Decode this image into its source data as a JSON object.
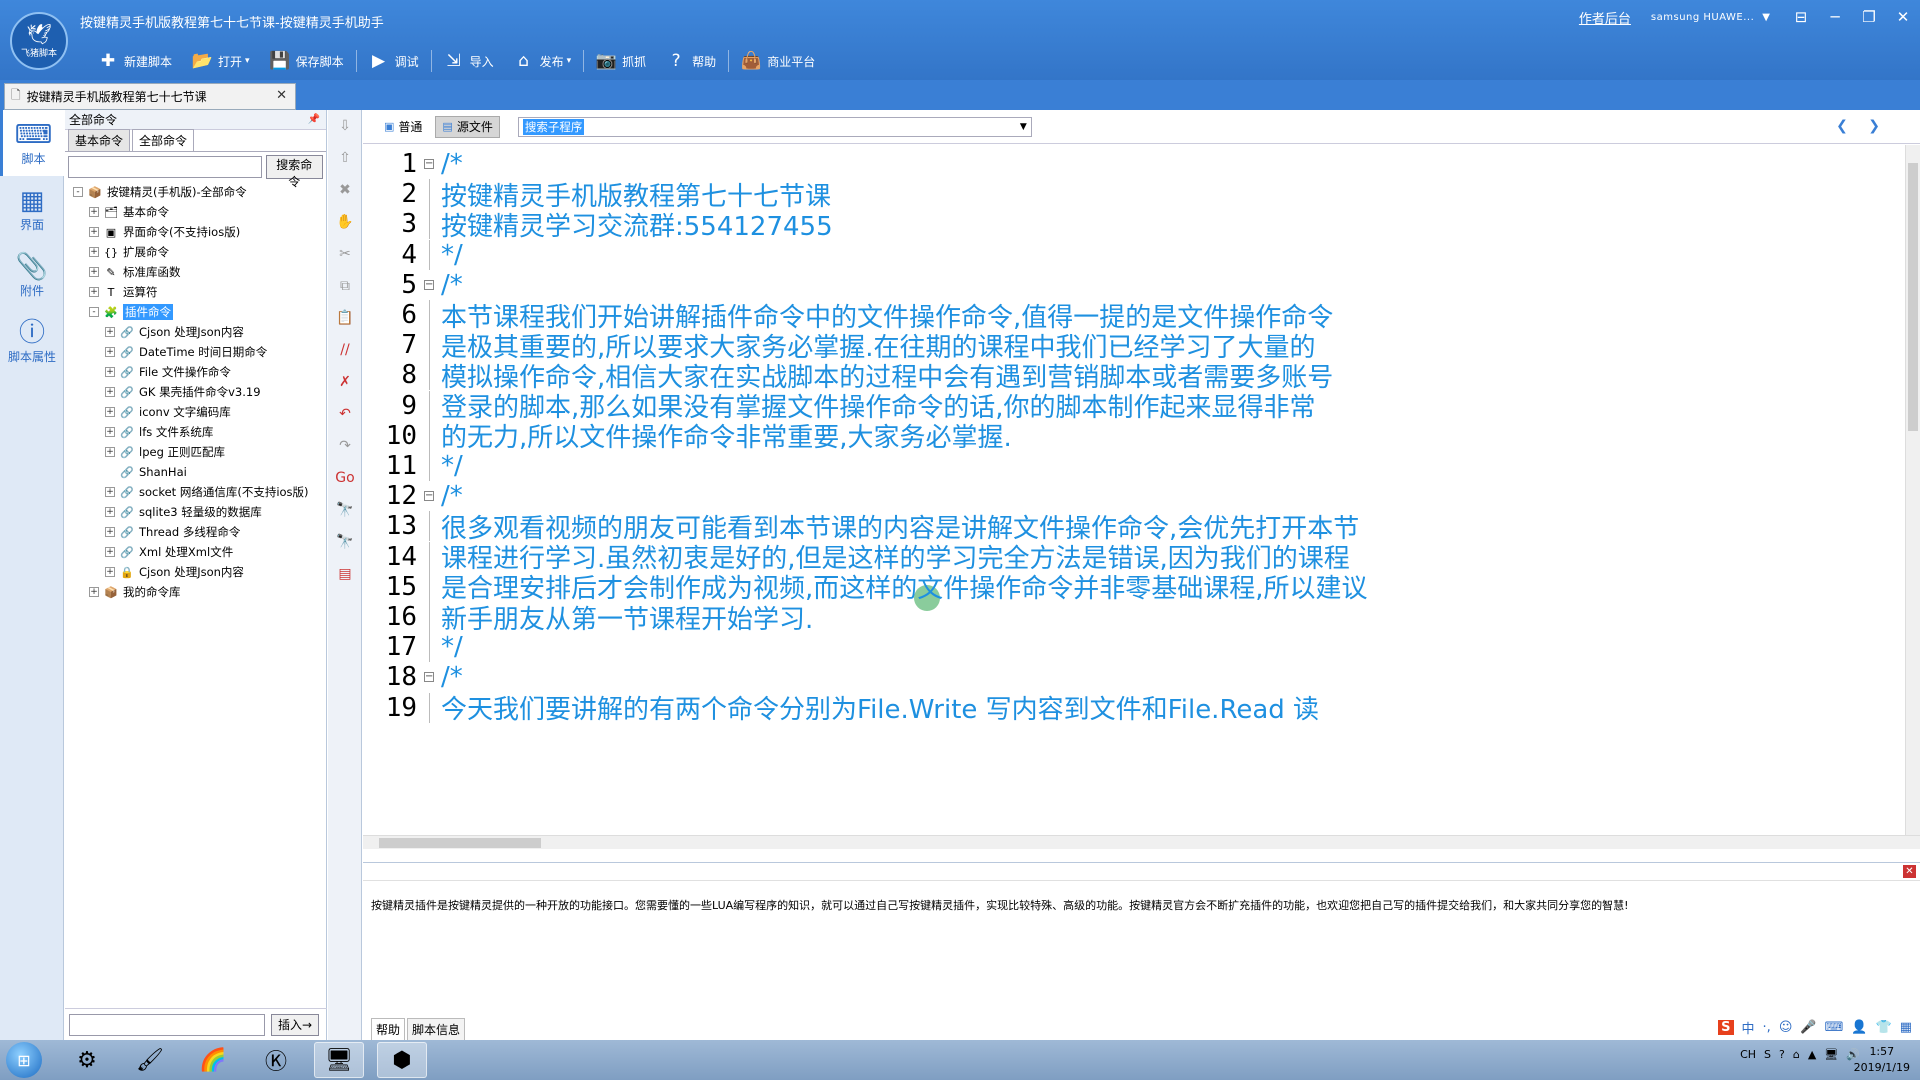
{
  "app": {
    "logo_text": "飞猪脚本",
    "window_title": "按键精灵手机版教程第七十七节课-按键精灵手机助手",
    "admin_link": "作者后台",
    "device": "samsung HUAWE...",
    "toolbar": [
      {
        "label": "新建脚本",
        "icon": "plus-icon",
        "glyph": "✚"
      },
      {
        "label": "打开",
        "icon": "folder-icon",
        "glyph": "📂",
        "dropdown": true
      },
      {
        "label": "保存脚本",
        "icon": "save-icon",
        "glyph": "💾"
      },
      {
        "label": "调试",
        "icon": "play-icon",
        "glyph": "▶"
      },
      {
        "label": "导入",
        "icon": "import-icon",
        "glyph": "⇲"
      },
      {
        "label": "发布",
        "icon": "publish-icon",
        "glyph": "⌂",
        "dropdown": true
      },
      {
        "label": "抓抓",
        "icon": "camera-icon",
        "glyph": "📷"
      },
      {
        "label": "帮助",
        "icon": "help-icon",
        "glyph": "?"
      },
      {
        "label": "商业平台",
        "icon": "shop-icon",
        "glyph": "👜"
      }
    ]
  },
  "doc_tab": {
    "label": "按键精灵手机版教程第七十七节课"
  },
  "left_nav": [
    {
      "label": "脚本",
      "icon": "script-icon",
      "glyph": "⌨"
    },
    {
      "label": "界面",
      "icon": "grid-icon",
      "glyph": "▦"
    },
    {
      "label": "附件",
      "icon": "attachment-icon",
      "glyph": "📎"
    },
    {
      "label": "脚本属性",
      "icon": "info-icon",
      "glyph": "ⓘ"
    }
  ],
  "command_panel": {
    "header": "全部命令",
    "pin": "📌",
    "tabs": [
      "基本命令",
      "全部命令"
    ],
    "search_button": "搜索命令",
    "insert_button": "插入→",
    "tree": [
      {
        "label": "按键精灵(手机版)-全部命令",
        "level": 0,
        "exp": "-",
        "icon": "📦"
      },
      {
        "label": "基本命令",
        "level": 1,
        "exp": "+",
        "icon": "🗂"
      },
      {
        "label": "界面命令(不支持ios版)",
        "level": 1,
        "exp": "+",
        "icon": "▣"
      },
      {
        "label": "扩展命令",
        "level": 1,
        "exp": "+",
        "icon": "{}"
      },
      {
        "label": "标准库函数",
        "level": 1,
        "exp": "+",
        "icon": "✎"
      },
      {
        "label": "运算符",
        "level": 1,
        "exp": "+",
        "icon": "T"
      },
      {
        "label": "插件命令",
        "level": 1,
        "exp": "-",
        "icon": "🧩",
        "selected": true
      },
      {
        "label": "Cjson 处理Json内容",
        "level": 2,
        "exp": "+",
        "icon": "🔗"
      },
      {
        "label": "DateTime 时间日期命令",
        "level": 2,
        "exp": "+",
        "icon": "🔗"
      },
      {
        "label": "File 文件操作命令",
        "level": 2,
        "exp": "+",
        "icon": "🔗"
      },
      {
        "label": "GK 果壳插件命令v3.19",
        "level": 2,
        "exp": "+",
        "icon": "🔗"
      },
      {
        "label": "iconv 文字编码库",
        "level": 2,
        "exp": "+",
        "icon": "🔗"
      },
      {
        "label": "lfs 文件系统库",
        "level": 2,
        "exp": "+",
        "icon": "🔗"
      },
      {
        "label": "lpeg 正则匹配库",
        "level": 2,
        "exp": "+",
        "icon": "🔗"
      },
      {
        "label": "ShanHai",
        "level": 2,
        "exp": "",
        "icon": "🔗"
      },
      {
        "label": "socket 网络通信库(不支持ios版)",
        "level": 2,
        "exp": "+",
        "icon": "🔗"
      },
      {
        "label": "sqlite3 轻量级的数据库",
        "level": 2,
        "exp": "+",
        "icon": "🔗"
      },
      {
        "label": "Thread 多线程命令",
        "level": 2,
        "exp": "+",
        "icon": "🔗"
      },
      {
        "label": "Xml 处理Xml文件",
        "level": 2,
        "exp": "+",
        "icon": "🔗"
      },
      {
        "label": "Cjson 处理Json内容",
        "level": 2,
        "exp": "+",
        "icon": "🔒"
      },
      {
        "label": "我的命令库",
        "level": 1,
        "exp": "+",
        "icon": "📦"
      }
    ]
  },
  "vtools": [
    {
      "icon": "arrow-down-icon",
      "glyph": "⇩",
      "on": false
    },
    {
      "icon": "arrow-up-icon",
      "glyph": "⇧",
      "on": false
    },
    {
      "icon": "delete-icon",
      "glyph": "✖",
      "on": false
    },
    {
      "icon": "hand-icon",
      "glyph": "✋",
      "on": true
    },
    {
      "icon": "cut-icon",
      "glyph": "✂",
      "on": false
    },
    {
      "icon": "copy-icon",
      "glyph": "⧉",
      "on": false
    },
    {
      "icon": "paste-icon",
      "glyph": "📋",
      "on": false
    },
    {
      "icon": "comment-icon",
      "glyph": "//",
      "on": true
    },
    {
      "icon": "uncomment-icon",
      "glyph": "✗",
      "on": true
    },
    {
      "icon": "undo-icon",
      "glyph": "↶",
      "on": true
    },
    {
      "icon": "redo-icon",
      "glyph": "↷",
      "on": false
    },
    {
      "icon": "goto-icon",
      "glyph": "Go",
      "on": true
    },
    {
      "icon": "find-icon",
      "glyph": "🔭",
      "on": true
    },
    {
      "icon": "replace-icon",
      "glyph": "🔭",
      "on": true
    },
    {
      "icon": "format-icon",
      "glyph": "▤",
      "on": true
    }
  ],
  "editor": {
    "modes": [
      {
        "label": "普通",
        "icon": "normal-view-icon",
        "glyph": "▣"
      },
      {
        "label": "源文件",
        "icon": "source-view-icon",
        "glyph": "▤",
        "active": true
      }
    ],
    "subroutine_select": "搜索子程序",
    "prev": "❮",
    "next": "❯",
    "lines": [
      {
        "n": "1",
        "text": "/*",
        "fold": "start"
      },
      {
        "n": "2",
        "text": "按键精灵手机版教程第七十七节课",
        "fold": "mid"
      },
      {
        "n": "3",
        "text": "按键精灵学习交流群:554127455",
        "fold": "mid"
      },
      {
        "n": "4",
        "text": "*/",
        "fold": "end"
      },
      {
        "n": "5",
        "text": "/*",
        "fold": "start"
      },
      {
        "n": "6",
        "text": "本节课程我们开始讲解插件命令中的文件操作命令,值得一提的是文件操作命令",
        "fold": "mid"
      },
      {
        "n": "7",
        "text": "是极其重要的,所以要求大家务必掌握.在往期的课程中我们已经学习了大量的",
        "fold": "mid"
      },
      {
        "n": "8",
        "text": "模拟操作命令,相信大家在实战脚本的过程中会有遇到营销脚本或者需要多账号",
        "fold": "mid"
      },
      {
        "n": "9",
        "text": "登录的脚本,那么如果没有掌握文件操作命令的话,你的脚本制作起来显得非常",
        "fold": "mid"
      },
      {
        "n": "10",
        "text": "的无力,所以文件操作命令非常重要,大家务必掌握.",
        "fold": "mid"
      },
      {
        "n": "11",
        "text": "*/",
        "fold": "end"
      },
      {
        "n": "12",
        "text": "/*",
        "fold": "start"
      },
      {
        "n": "13",
        "text": "很多观看视频的朋友可能看到本节课的内容是讲解文件操作命令,会优先打开本节",
        "fold": "mid"
      },
      {
        "n": "14",
        "text": "课程进行学习.虽然初衷是好的,但是这样的学习完全方法是错误,因为我们的课程",
        "fold": "mid"
      },
      {
        "n": "15",
        "text": "是合理安排后才会制作成为视频,而这样的文件操作命令并非零基础课程,所以建议",
        "fold": "mid"
      },
      {
        "n": "16",
        "text": "新手朋友从第一节课程开始学习.",
        "fold": "mid"
      },
      {
        "n": "17",
        "text": "*/",
        "fold": "end"
      },
      {
        "n": "18",
        "text": "/*",
        "fold": "start"
      },
      {
        "n": "19",
        "text": "今天我们要讲解的有两个命令分别为File.Write 写内容到文件和File.Read 读",
        "fold": "mid"
      }
    ]
  },
  "help": {
    "text": "按键精灵插件是按键精灵提供的一种开放的功能接口。您需要懂的一些LUA编写程序的知识，就可以通过自己写按键精灵插件，实现比较特殊、高级的功能。按键精灵官方会不断扩充插件的功能，也欢迎您把自己写的插件提交给我们，和大家共同分享您的智慧!",
    "tabs": [
      "帮助",
      "脚本信息"
    ]
  },
  "ime": [
    "S",
    "中",
    "·,",
    "☺",
    "🎤",
    "⌨",
    "👤",
    "👕",
    "▦"
  ],
  "taskbar": {
    "apps": [
      {
        "icon": "app-connect-icon",
        "glyph": "⚙"
      },
      {
        "icon": "app-brush-icon",
        "glyph": "🖌"
      },
      {
        "icon": "app-color-icon",
        "glyph": "🌈"
      },
      {
        "icon": "app-k-icon",
        "glyph": "Ⓚ"
      },
      {
        "icon": "app-anjian-icon",
        "glyph": "🖥",
        "active": true
      },
      {
        "icon": "app-nox-icon",
        "glyph": "⬢",
        "active": true
      }
    ],
    "tray": [
      "CH",
      "S",
      "?",
      "⌂",
      "▲",
      "🖥",
      "🔊"
    ],
    "time": "1:57",
    "date": "2019/1/19"
  }
}
